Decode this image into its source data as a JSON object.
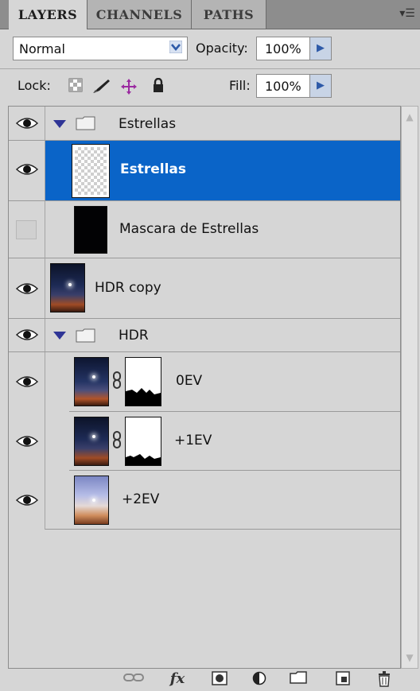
{
  "tabs": [
    {
      "label": "LAYERS",
      "active": true
    },
    {
      "label": "CHANNELS",
      "active": false
    },
    {
      "label": "PATHS",
      "active": false
    }
  ],
  "panel_menu_icon": "panel-menu-icon",
  "blend": {
    "value": "Normal",
    "opacity_label": "Opacity:",
    "opacity": "100%"
  },
  "lock": {
    "label": "Lock:",
    "fill_label": "Fill:",
    "fill": "100%"
  },
  "layers": [
    {
      "name": "Estrellas",
      "kind": "group",
      "visible": true,
      "expanded": true
    },
    {
      "name": "Estrellas",
      "kind": "layer",
      "visible": true,
      "selected": true,
      "thumb": "transparent"
    },
    {
      "name": "Mascara de Estrellas",
      "kind": "layer",
      "visible": false,
      "thumb": "black"
    },
    {
      "name": "HDR copy",
      "kind": "layer",
      "visible": true,
      "thumb": "night"
    },
    {
      "name": "HDR",
      "kind": "group",
      "visible": true,
      "expanded": true
    },
    {
      "name": "0EV",
      "kind": "layer",
      "visible": true,
      "thumb": "night",
      "mask": true
    },
    {
      "name": "+1EV",
      "kind": "layer",
      "visible": true,
      "thumb": "night",
      "mask": true
    },
    {
      "name": "+2EV",
      "kind": "layer",
      "visible": true,
      "thumb": "bright"
    }
  ],
  "colors": {
    "selection": "#0a64c8",
    "panel": "#d6d6d6",
    "accent": "#2e5aa8"
  },
  "bottom_tools": [
    "link-layers-icon",
    "fx-icon",
    "add-mask-icon",
    "adjustment-layer-icon",
    "new-group-icon",
    "new-layer-icon",
    "trash-icon"
  ],
  "fx_label": "fx"
}
